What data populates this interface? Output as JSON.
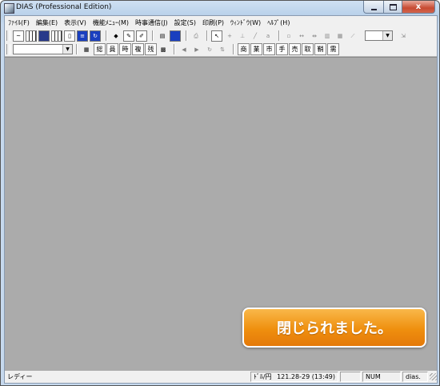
{
  "window": {
    "title": "DIAS (Professional Edition)",
    "close_glyph": "x"
  },
  "menu": [
    "ﾌｧｲﾙ(F)",
    "編集(E)",
    "表示(V)",
    "機能ﾒﾆｭｰ(M)",
    "時事通信(J)",
    "設定(S)",
    "印刷(P)",
    "ｳｨﾝﾄﾞｳ(W)",
    "ﾍﾙﾌﾟ(H)"
  ],
  "toolbar2": {
    "left_combo_value": "",
    "kanji_buttons": [
      "総",
      "員",
      "時",
      "複",
      "残"
    ],
    "market_buttons": [
      "商",
      "業",
      "市",
      "手",
      "売",
      "取",
      "鞘",
      "需"
    ]
  },
  "toolbar1": {
    "right_combo_value": ""
  },
  "notification": {
    "text": "閉じられました。"
  },
  "status": {
    "ready_text": "レディー",
    "fx_label": "ﾄﾞﾙ/円",
    "fx_value": "121.28-29",
    "fx_time": "(13:49)",
    "num_indicator": "NUM",
    "app_indicator": "dias."
  }
}
